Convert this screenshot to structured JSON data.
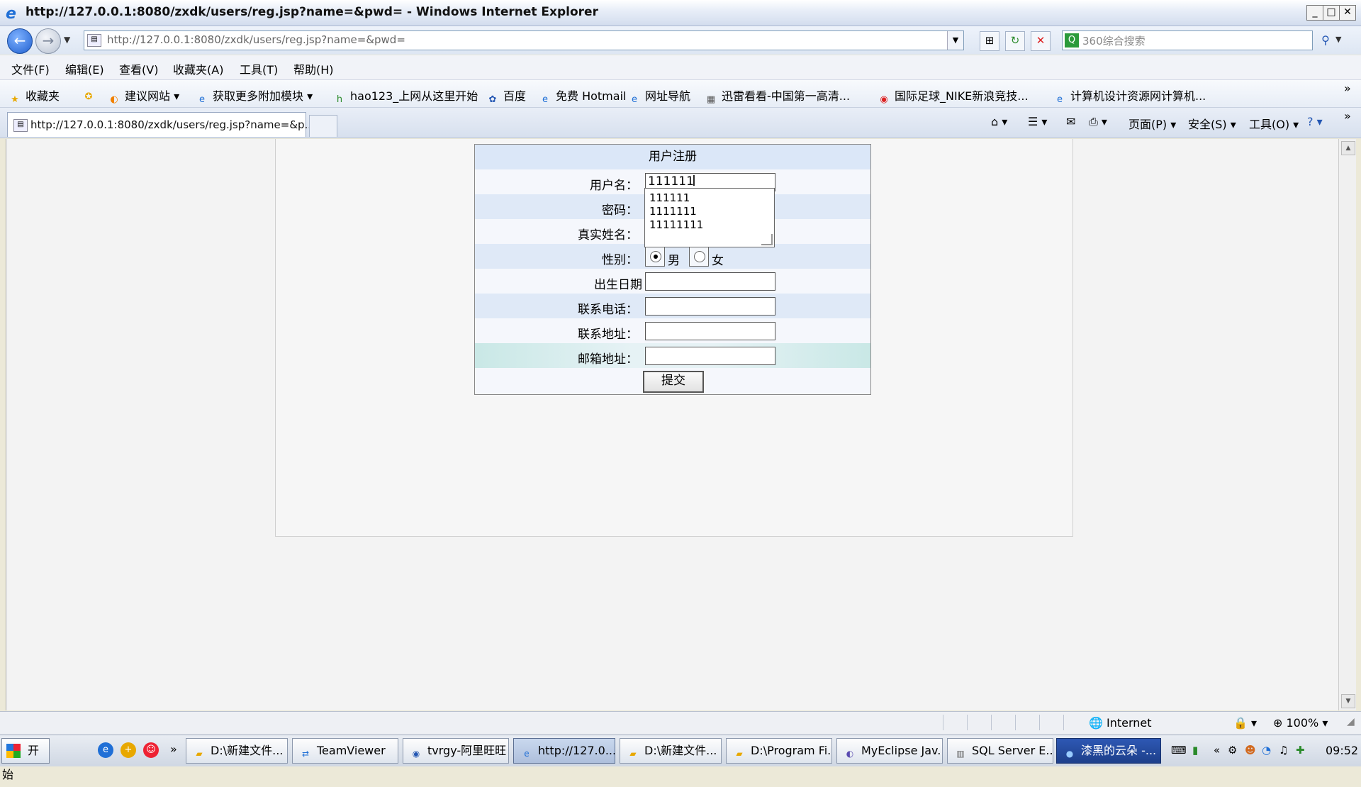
{
  "window": {
    "title": "http://127.0.0.1:8080/zxdk/users/reg.jsp?name=&pwd= - Windows Internet Explorer"
  },
  "addressbar": {
    "url": "http://127.0.0.1:8080/zxdk/users/reg.jsp?name=&pwd=",
    "search_placeholder": "360综合搜索"
  },
  "menu": [
    "文件(F)",
    "编辑(E)",
    "查看(V)",
    "收藏夹(A)",
    "工具(T)",
    "帮助(H)"
  ],
  "favorites": {
    "label": "收藏夹",
    "items": [
      "建议网站",
      "获取更多附加模块",
      "hao123_上网从这里开始",
      "百度",
      "免费 Hotmail",
      "网址导航",
      "迅雷看看-中国第一高清...",
      "国际足球_NIKE新浪竞技...",
      "计算机设计资源网计算机..."
    ]
  },
  "tab": {
    "title": "http://127.0.0.1:8080/zxdk/users/reg.jsp?name=&p..."
  },
  "commandbar": {
    "page": "页面(P)",
    "safety": "安全(S)",
    "tools": "工具(O)"
  },
  "form": {
    "caption": "用户注册",
    "username_label": "用户名：",
    "username_value": "111111",
    "password_label": "密码：",
    "realname_label": "真实姓名：",
    "gender_label": "性别：",
    "gender_male": "男",
    "gender_female": "女",
    "gender_selected": "男",
    "birthdate_label": "出生日期",
    "phone_label": "联系电话：",
    "address_label": "联系地址：",
    "email_label": "邮箱地址：",
    "submit_label": "提交",
    "autocomplete": [
      "111111",
      "1111111",
      "11111111"
    ]
  },
  "statusbar": {
    "zone": "Internet",
    "zoom": "100%"
  },
  "taskbar": {
    "start": "开始",
    "tasks": [
      "D:\\新建文件...",
      "TeamViewer",
      "tvrgy-阿里旺旺",
      "http://127.0....",
      "D:\\新建文件...",
      "D:\\Program Fi...",
      "MyEclipse Jav...",
      "SQL Server E...",
      "漆黑的云朵 -..."
    ],
    "clock": "09:52"
  },
  "colors": {
    "accent": "#1f5fcf",
    "form_row_blue": "#dfe9f7",
    "form_caption": "#dbe7f8"
  }
}
